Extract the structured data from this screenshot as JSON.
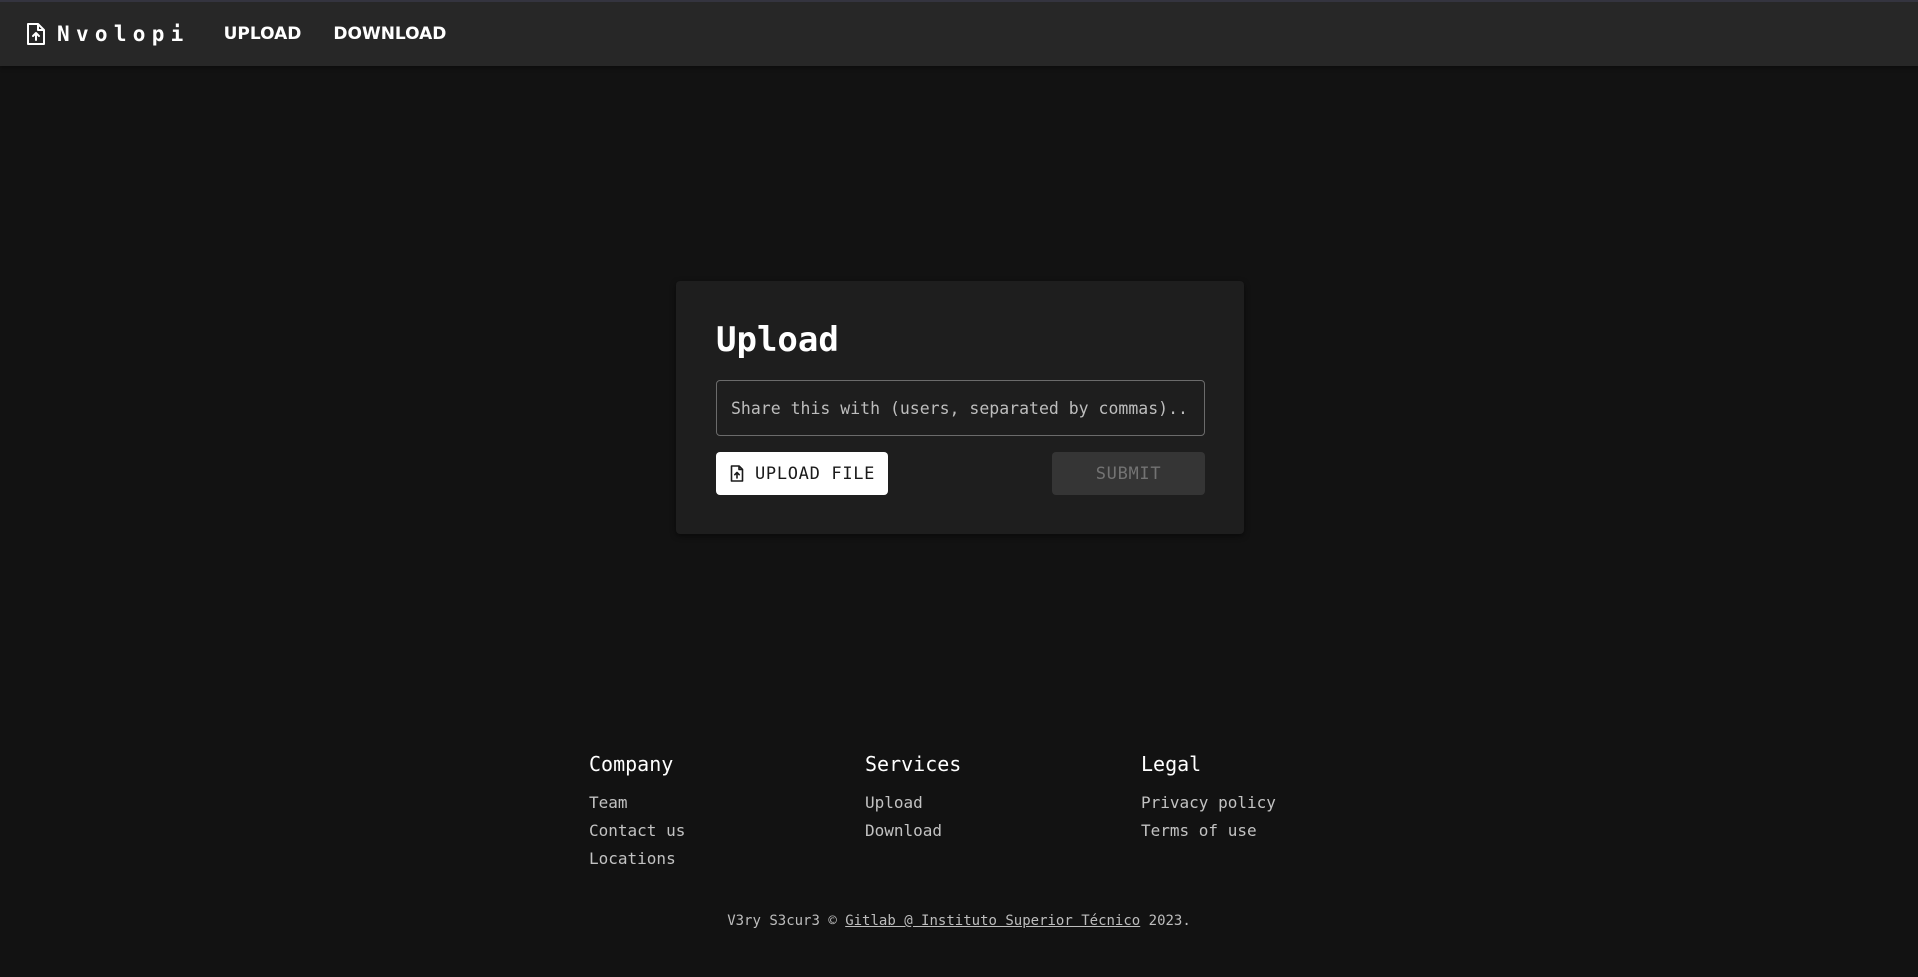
{
  "appbar": {
    "brand_name": "Nvolopi",
    "brand_icon": "file-upload-icon",
    "nav": [
      {
        "label": "UPLOAD"
      },
      {
        "label": "DOWNLOAD"
      }
    ]
  },
  "upload_card": {
    "title": "Upload",
    "share_input": {
      "value": "",
      "placeholder": "Share this with (users, separated by commas)..."
    },
    "upload_button": {
      "label": "UPLOAD FILE",
      "icon": "file-upload-icon"
    },
    "submit_button": {
      "label": "SUBMIT",
      "disabled": true
    }
  },
  "footer": {
    "columns": [
      {
        "heading": "Company",
        "links": [
          "Team",
          "Contact us",
          "Locations"
        ]
      },
      {
        "heading": "Services",
        "links": [
          "Upload",
          "Download"
        ]
      },
      {
        "heading": "Legal",
        "links": [
          "Privacy policy",
          "Terms of use"
        ]
      }
    ],
    "copyright": {
      "prefix": "V3ry S3cur3 © ",
      "link": "Gitlab @ Instituto Superior Técnico",
      "suffix": " 2023."
    }
  },
  "colors": {
    "background": "#121212",
    "appbar": "#272727",
    "card": "#1e1e1e",
    "button_primary": "#ffffff",
    "button_disabled": "#353535"
  }
}
